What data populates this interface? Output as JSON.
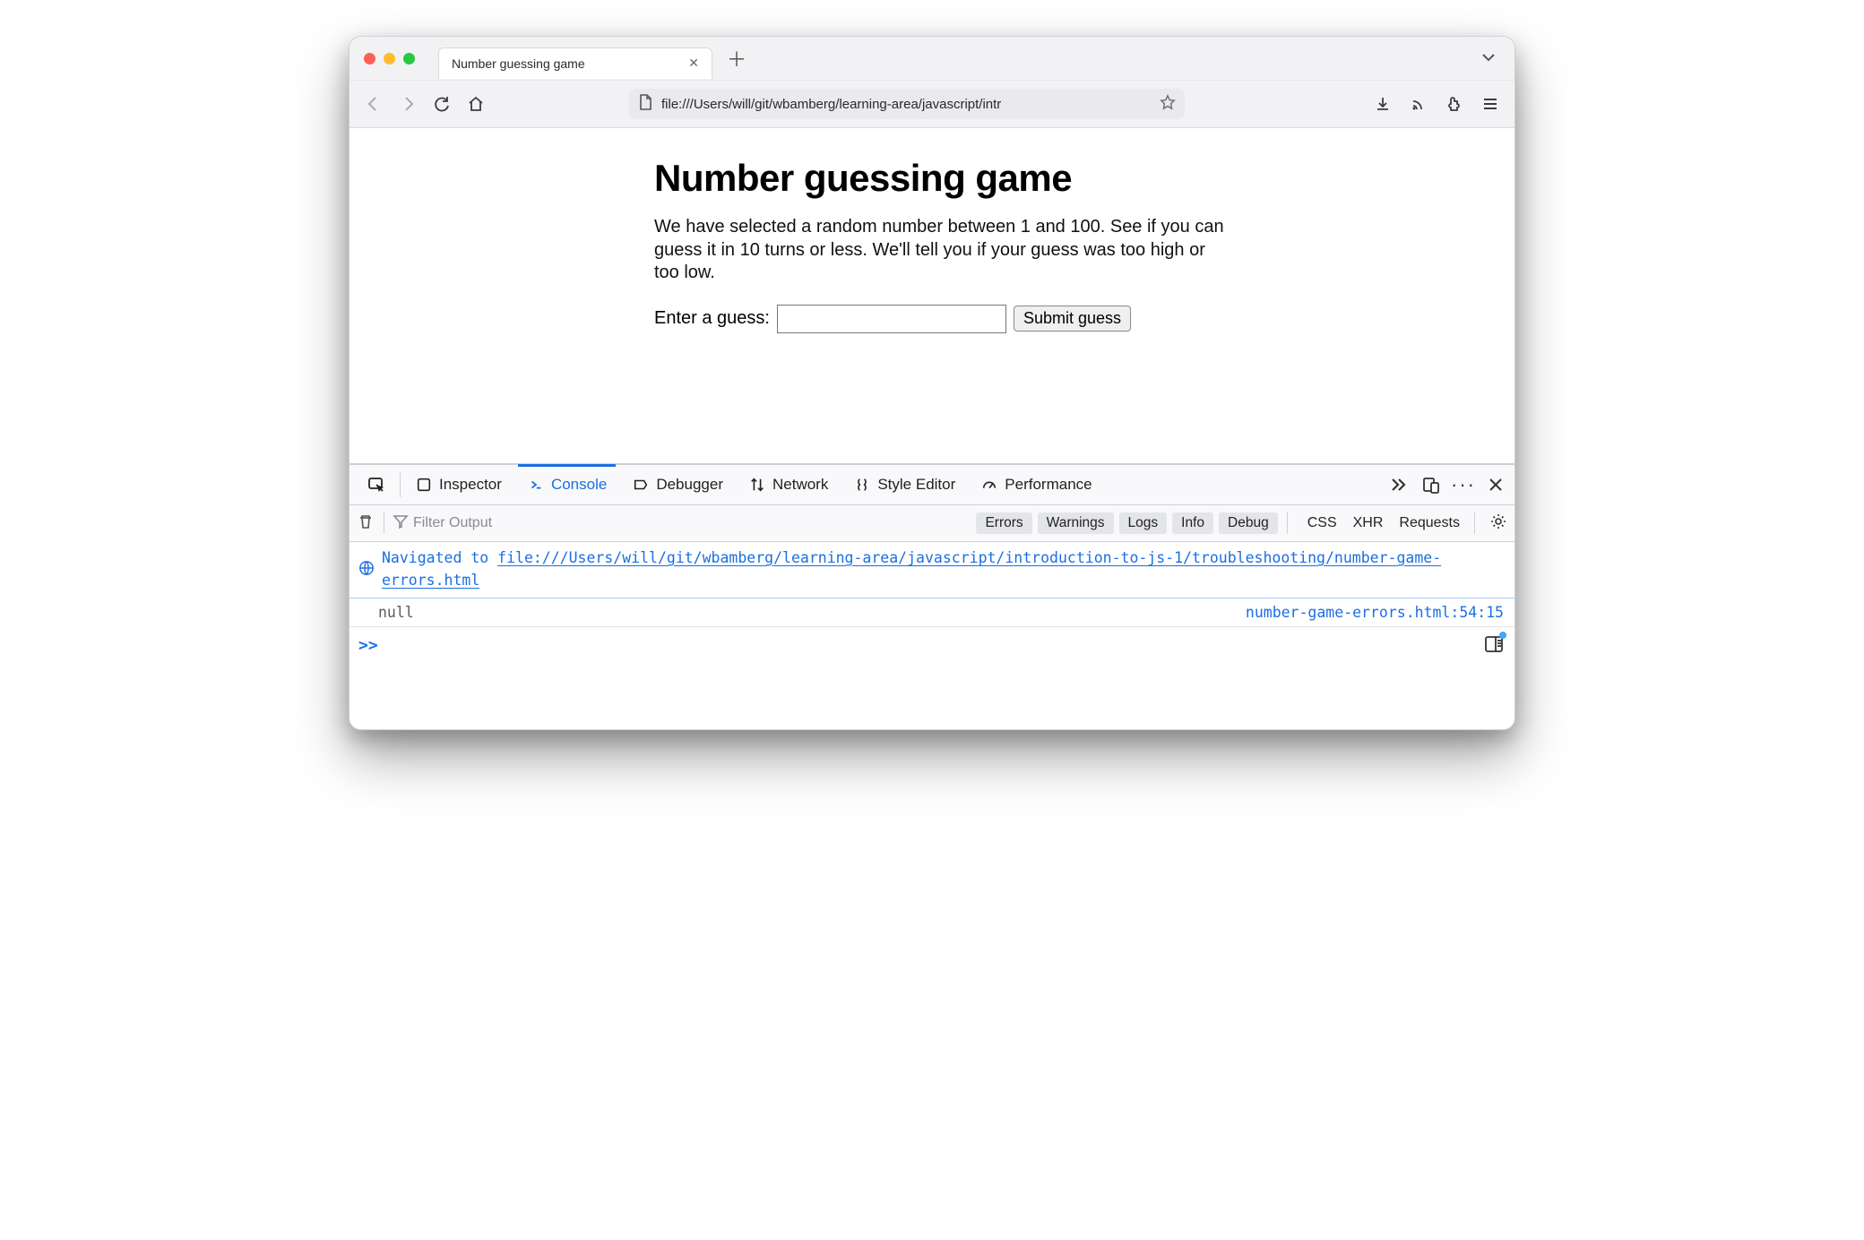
{
  "window": {
    "tab_title": "Number guessing game",
    "url_display": "file:///Users/will/git/wbamberg/learning-area/javascript/intr"
  },
  "page": {
    "heading": "Number guessing game",
    "description": "We have selected a random number between 1 and 100. See if you can guess it in 10 turns or less. We'll tell you if your guess was too high or too low.",
    "form": {
      "label": "Enter a guess:",
      "input_value": "",
      "submit_label": "Submit guess"
    }
  },
  "devtools": {
    "tabs": {
      "inspector": "Inspector",
      "console": "Console",
      "debugger": "Debugger",
      "network": "Network",
      "style_editor": "Style Editor",
      "performance": "Performance"
    },
    "filter": {
      "placeholder": "Filter Output",
      "levels": {
        "errors": "Errors",
        "warnings": "Warnings",
        "logs": "Logs",
        "info": "Info",
        "debug": "Debug"
      },
      "categories": {
        "css": "CSS",
        "xhr": "XHR",
        "requests": "Requests"
      }
    },
    "log": {
      "nav_prefix": "Navigated to ",
      "nav_url": "file:///Users/will/git/wbamberg/learning-area/javascript/introduction-to-js-1/troubleshooting/number-game-errors.html",
      "null_msg": "null",
      "source_file": "number-game-errors.html",
      "source_line": "54",
      "source_col": "15"
    }
  }
}
